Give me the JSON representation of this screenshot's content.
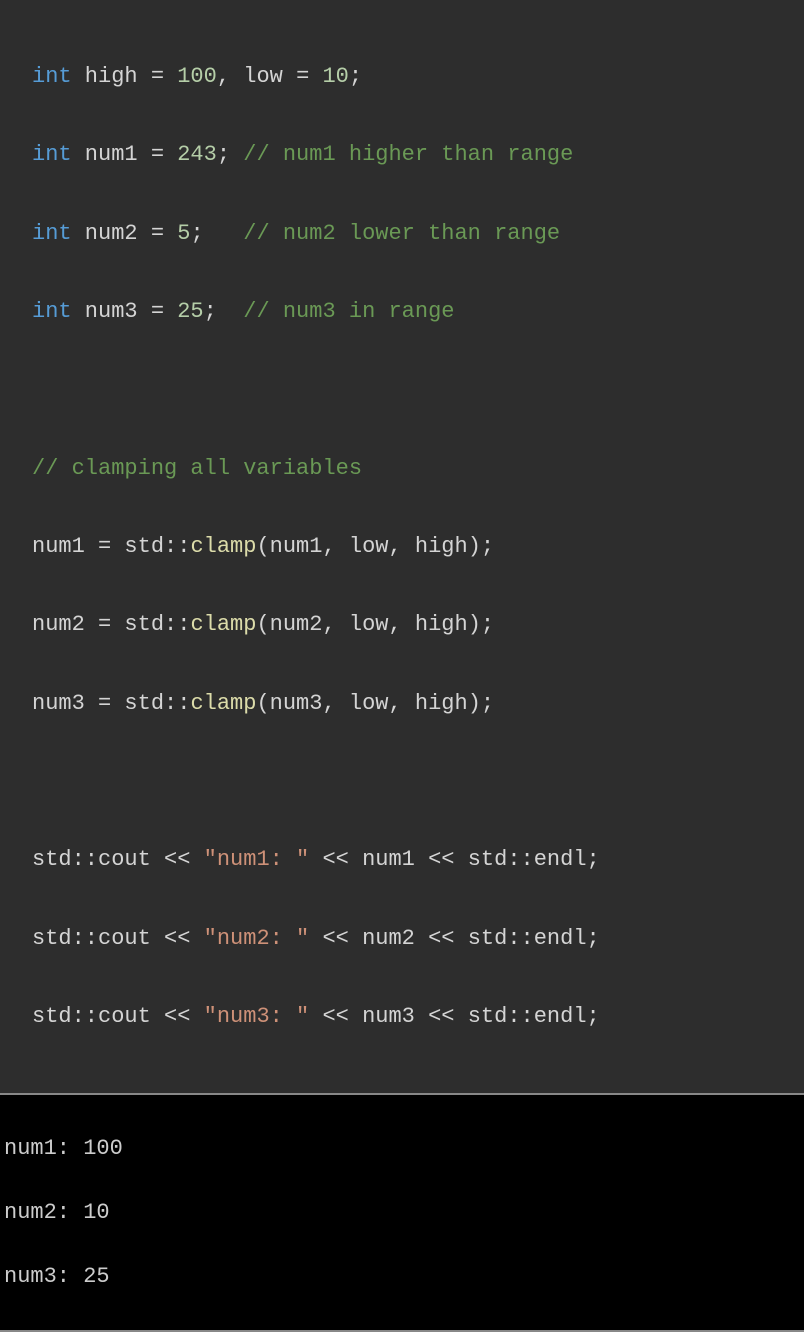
{
  "code": {
    "l1": {
      "kw": "int",
      "sp1": " high ",
      "eq": "= ",
      "n1": "100",
      "mid": ", low ",
      "eq2": "= ",
      "n2": "10",
      "semi": ";"
    },
    "l2": {
      "kw": "int",
      "sp1": " num1 ",
      "eq": "= ",
      "n1": "243",
      "semi": "; ",
      "cmt": "// num1 higher than range"
    },
    "l3": {
      "kw": "int",
      "sp1": " num2 ",
      "eq": "= ",
      "n1": "5",
      "semi": ";   ",
      "cmt": "// num2 lower than range"
    },
    "l4": {
      "kw": "int",
      "sp1": " num3 ",
      "eq": "= ",
      "n1": "25",
      "semi": ";  ",
      "cmt": "// num3 in range"
    },
    "l5": {
      "cmt": "// clamping all variables"
    },
    "l6": {
      "lhs": "num1 ",
      "eq": "= std",
      "cc": "::",
      "fn": "clamp",
      "args": "(num1, low, high);"
    },
    "l7": {
      "lhs": "num2 ",
      "eq": "= std",
      "cc": "::",
      "fn": "clamp",
      "args": "(num2, low, high);"
    },
    "l8": {
      "lhs": "num3 ",
      "eq": "= std",
      "cc": "::",
      "fn": "clamp",
      "args": "(num3, low, high);"
    },
    "l9": {
      "head": "std",
      "cc1": "::",
      "cout": "cout ",
      "ins1": "<< ",
      "str": "\"num1: \"",
      "ins2": " << num1 << std",
      "cc2": "::",
      "endl": "endl;"
    },
    "l10": {
      "head": "std",
      "cc1": "::",
      "cout": "cout ",
      "ins1": "<< ",
      "str": "\"num2: \"",
      "ins2": " << num2 << std",
      "cc2": "::",
      "endl": "endl;"
    },
    "l11": {
      "head": "std",
      "cc1": "::",
      "cout": "cout ",
      "ins1": "<< ",
      "str": "\"num3: \"",
      "ins2": " << num3 << std",
      "cc2": "::",
      "endl": "endl;"
    }
  },
  "terminal": {
    "line1": "num1: 100",
    "line2": "num2: 10",
    "line3": "num3: 25"
  }
}
